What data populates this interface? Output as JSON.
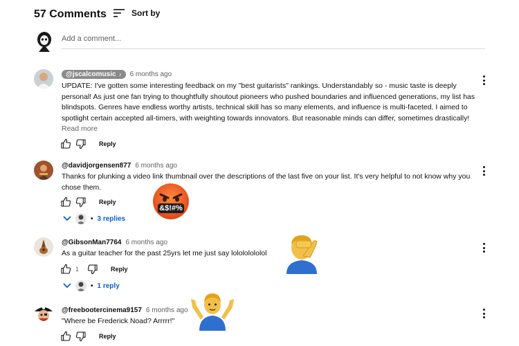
{
  "header": {
    "count_title": "57 Comments",
    "sort_label": "Sort by"
  },
  "add_comment": {
    "placeholder": "Add a comment..."
  },
  "comments": [
    {
      "handle": "@jscalcomusic",
      "time": "6 months ago",
      "text": "UPDATE: I've gotten some interesting feedback on my \"best guitarists\" rankings. Understandably so - music taste is deeply personal! As just one fan trying to thoughtfully shoutout pioneers who pushed boundaries and influenced generations, my list has blindspots. Genres have endless worthy artists, technical skill has so many elements, and influence is multi-faceted. I aimed to spotlight certain accepted all-timers, with weighting towards innovators. But reasonable minds can differ, sometimes drastically! So I view this as a ..",
      "read_more": "Read more",
      "reply_label": "Reply"
    },
    {
      "handle": "@davidjorgensen877",
      "time": "6 months ago",
      "text": "Thanks for plunking a video link thumbnail over the descriptions of the last five on your list. It's very helpful to not know why you chose them.",
      "reply_label": "Reply",
      "replies": "3 replies"
    },
    {
      "handle": "@GibsonMan7764",
      "time": "6 months ago",
      "text": "As a guitar teacher for the past 25yrs let me just say lolololololol",
      "likes": "1",
      "reply_label": "Reply",
      "replies": "1 reply"
    },
    {
      "handle": "@freebootercinema9157",
      "time": "6 months ago",
      "text": "\"Where be Frederick Noad?  Arrrrr!\"",
      "reply_label": "Reply"
    }
  ],
  "emoji_overlays": {
    "angry_symbols": "&$!#%"
  },
  "colors": {
    "link_blue": "#065fd4",
    "secondary_text": "#606060",
    "badge_grey": "#8a8a8a"
  }
}
